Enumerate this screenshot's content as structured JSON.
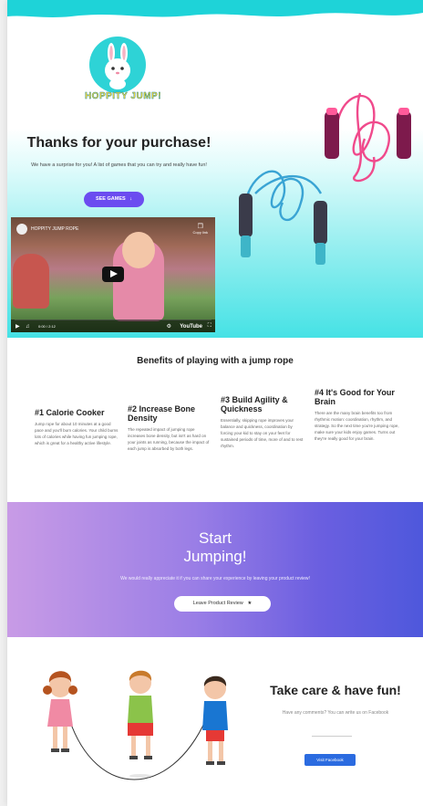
{
  "hero": {
    "logo_text": "HOPPITY JUMP!",
    "title": "Thanks for your purchase!",
    "subtitle": "We have a surprise for you! A list of games that you can try and really have fun!",
    "see_games_label": "SEE GAMES",
    "see_games_icon": "arrow-down-icon"
  },
  "video": {
    "title": "HOPPITY JUMP ROPE",
    "copy_link_label": "Copy link",
    "time": "0:00 / 2:12",
    "brand": "YouTube"
  },
  "benefits": {
    "title": "Benefits of playing with a jump rope",
    "items": [
      {
        "heading": "#1 Calorie Cooker",
        "text": "Jump rope for about 10 minutes at a good pace and you'll burn calories. Your child burns lots of calories while having fun jumping rope, which is great for a healthy active lifestyle."
      },
      {
        "heading": "#2 Increase Bone Density",
        "text": "The repeated impact of jumping rope increases bone density, but isn't as hard on your joints as running, because the impact of each jump is absorbed by both legs."
      },
      {
        "heading": "#3 Build Agility & Quickness",
        "text": "Essentially, skipping rope improves your balance and quickness, coordination by forcing your kid to stay on your feet for sustained periods of time, more of and to rest rhythm."
      },
      {
        "heading": "#4 It's Good for Your Brain",
        "text": "There are the many brain benefits too from rhythmic motion: coordination, rhythm, and strategy. So the next time you're jumping rope, make sure your kids enjoy games. Turns out they're really good for your brain."
      }
    ]
  },
  "cta": {
    "title_line1": "Start",
    "title_line2": "Jumping!",
    "subtitle": "We would really appreciate it if you can share your experience by leaving your product review!",
    "review_label": "Leave Product Review",
    "review_icon": "star-icon"
  },
  "footer": {
    "title": "Take care & have fun!",
    "subtitle": "Have any comments? You can write us on Facebook",
    "facebook_label": "Visit Facebook"
  },
  "colors": {
    "accent_purple": "#6b4cf0",
    "cyan": "#2ed3d6",
    "facebook_blue": "#2b6be0"
  }
}
